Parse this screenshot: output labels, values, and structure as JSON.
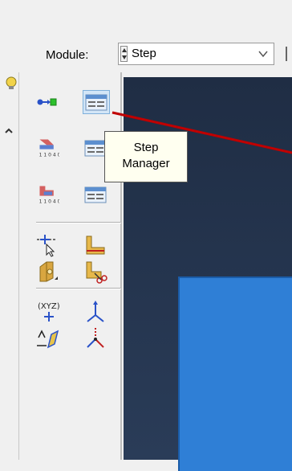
{
  "module": {
    "label": "Module:",
    "selected": "Step"
  },
  "tooltip": {
    "line1": "Step",
    "line2": "Manager"
  },
  "tools": [
    {
      "icon": "create-step-icon",
      "active": false
    },
    {
      "icon": "step-manager-icon",
      "active": true
    },
    {
      "icon": "field-output-request-icon",
      "active": false
    },
    {
      "icon": "field-output-manager-icon",
      "active": false
    },
    {
      "icon": "history-output-request-icon",
      "active": false
    },
    {
      "icon": "history-output-manager-icon",
      "active": false
    },
    {
      "icon": "query-icon",
      "active": false
    },
    {
      "icon": "partition-icon",
      "active": false
    },
    {
      "icon": "datum-icon",
      "active": false
    },
    {
      "icon": "cut-partition-icon",
      "active": false
    },
    {
      "icon": "xyz-datum-point-icon",
      "active": false
    },
    {
      "icon": "csys-axes-icon",
      "active": false
    },
    {
      "icon": "datum-plane-icon",
      "active": false
    },
    {
      "icon": "csys-red-icon",
      "active": false
    }
  ],
  "colors": {
    "viewport": "#1f2d44",
    "part": "#2f7fd6",
    "annotation_arrow": "#c00000"
  }
}
